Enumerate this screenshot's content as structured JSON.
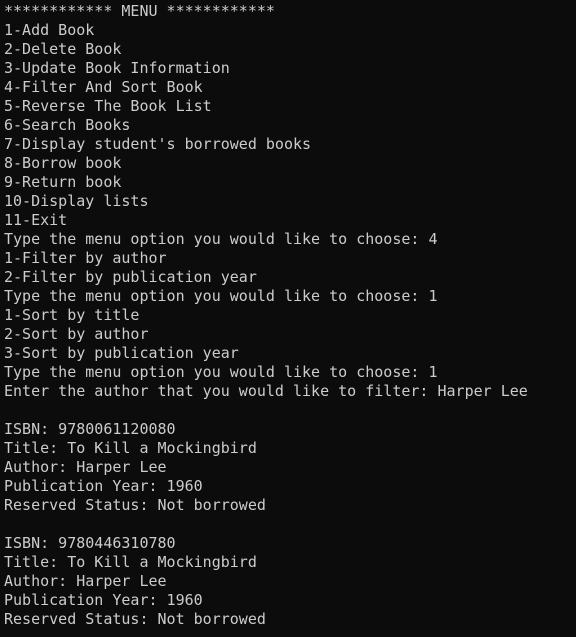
{
  "terminal": {
    "background_color": "#0c0c0c",
    "text_color": "#cccccc",
    "lines": [
      "************ MENU ************",
      "1-Add Book",
      "2-Delete Book",
      "3-Update Book Information",
      "4-Filter And Sort Book",
      "5-Reverse The Book List",
      "6-Search Books",
      "7-Display student's borrowed books",
      "8-Borrow book",
      "9-Return book",
      "10-Display lists",
      "11-Exit",
      "Type the menu option you would like to choose: 4",
      "1-Filter by author",
      "2-Filter by publication year",
      "Type the menu option you would like to choose: 1",
      "1-Sort by title",
      "2-Sort by author",
      "3-Sort by publication year",
      "Type the menu option you would like to choose: 1",
      "Enter the author that you would like to filter: Harper Lee",
      "",
      "ISBN: 9780061120080",
      "Title: To Kill a Mockingbird",
      "Author: Harper Lee",
      "Publication Year: 1960",
      "Reserved Status: Not borrowed",
      "",
      "ISBN: 9780446310780",
      "Title: To Kill a Mockingbird",
      "Author: Harper Lee",
      "Publication Year: 1960",
      "Reserved Status: Not borrowed"
    ]
  }
}
